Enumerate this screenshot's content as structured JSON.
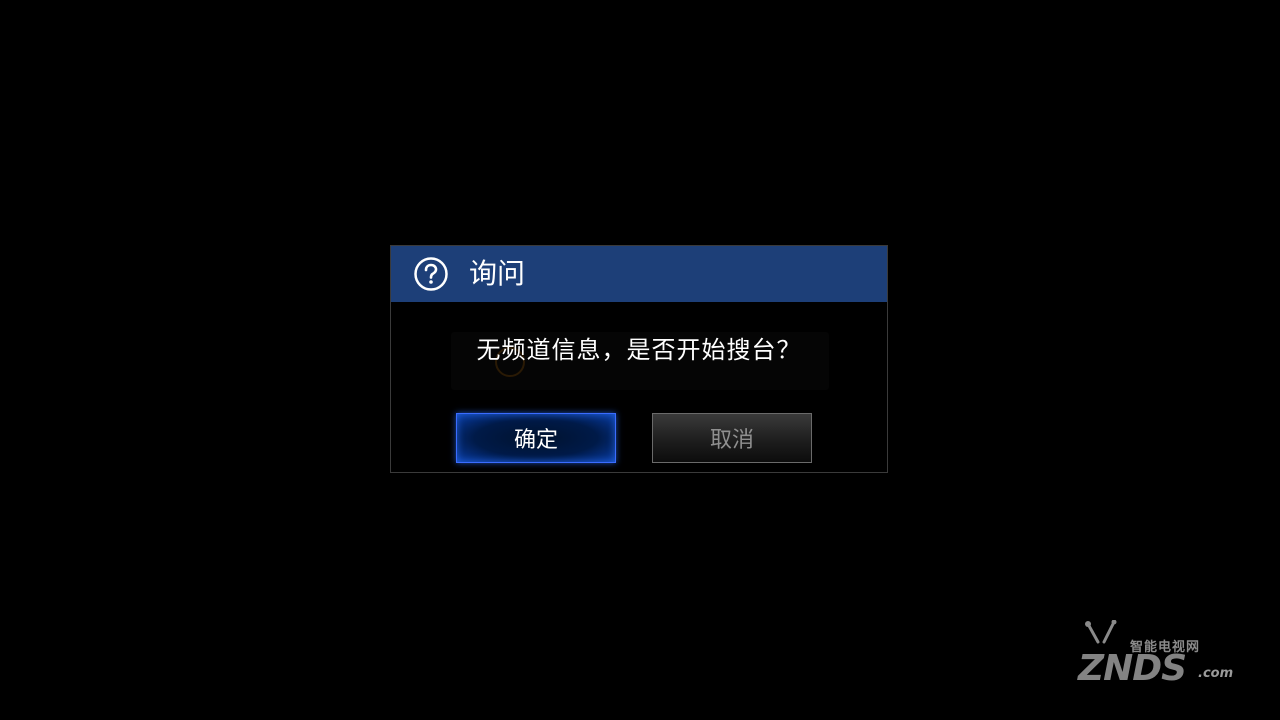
{
  "dialog": {
    "title": "询问",
    "icon": "question-circle-icon",
    "message": "无频道信息，是否开始搜台？",
    "buttons": {
      "confirm_label": "确定",
      "cancel_label": "取消"
    },
    "colors": {
      "header": "#1d3f78",
      "focus_border": "#3b6cff"
    }
  },
  "watermark": {
    "cn_text": "智能电视网",
    "logo_text": "ZNDS",
    "suffix": ".com"
  }
}
